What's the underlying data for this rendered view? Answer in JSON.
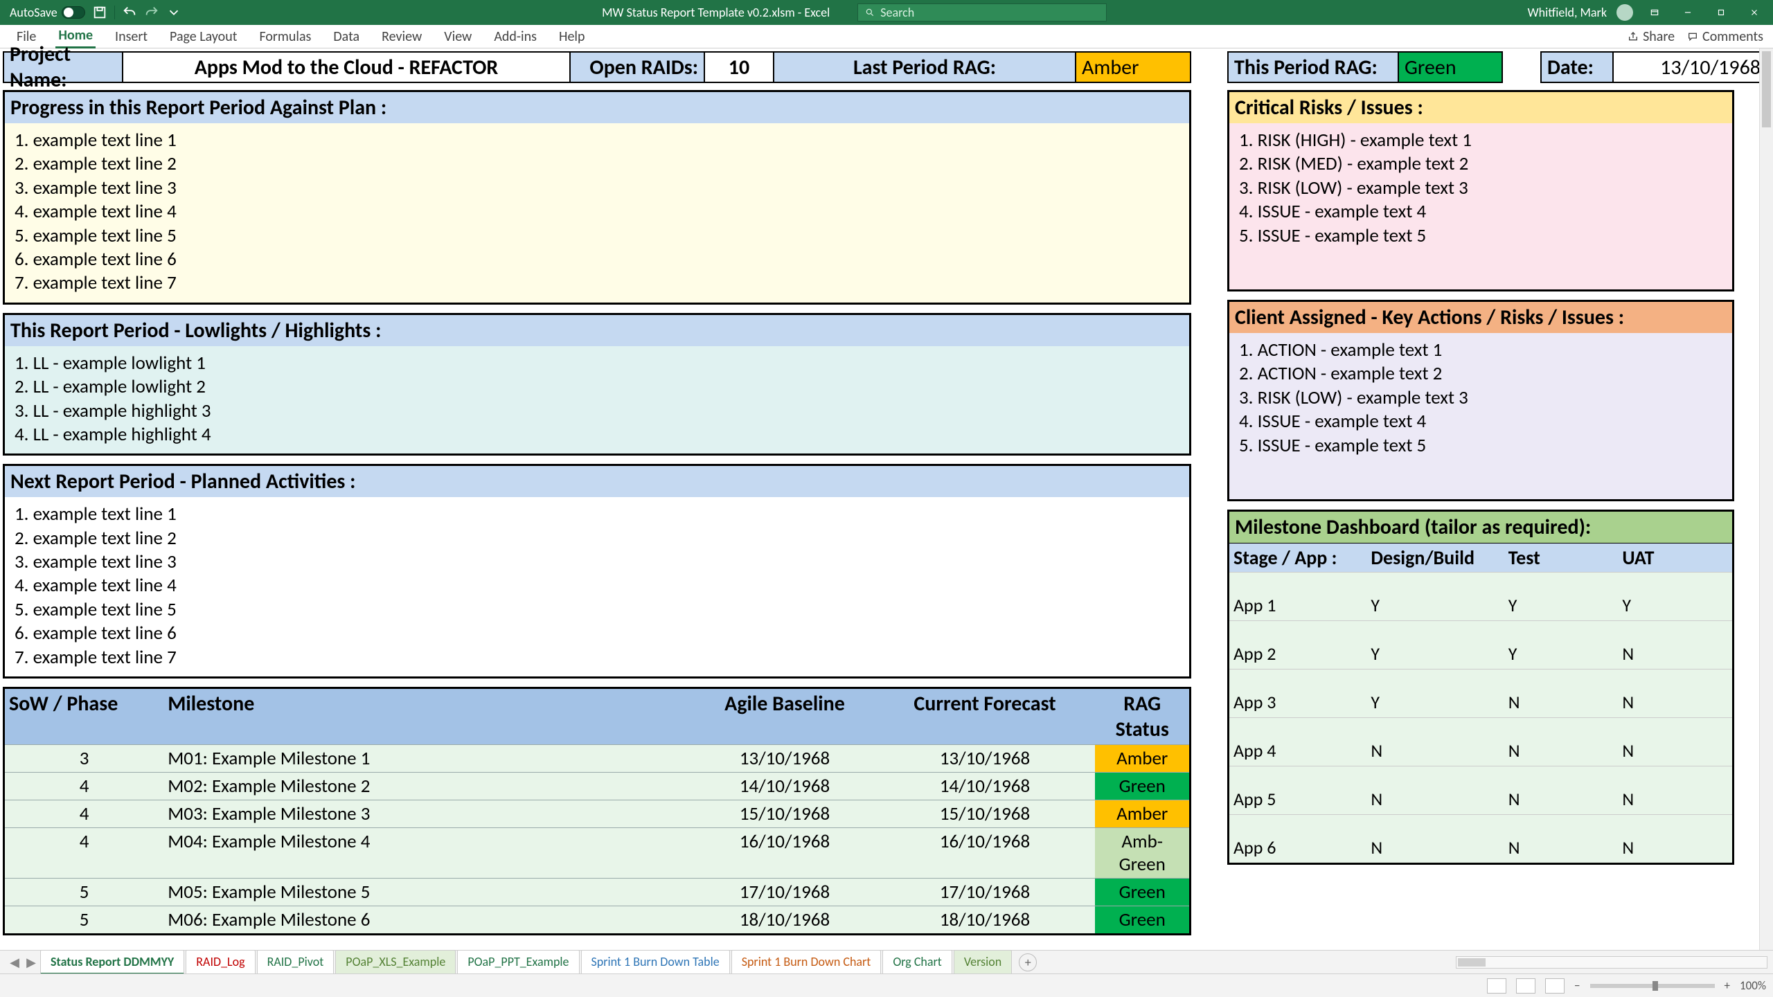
{
  "titlebar": {
    "autosave_label": "AutoSave",
    "doc_title": "MW Status Report Template v0.2.xlsm  -  Excel",
    "search_placeholder": "Search",
    "user_name": "Whitfield, Mark"
  },
  "ribbon": {
    "tabs": [
      "File",
      "Home",
      "Insert",
      "Page Layout",
      "Formulas",
      "Data",
      "Review",
      "View",
      "Add-ins",
      "Help"
    ],
    "active_index": 1,
    "share": "Share",
    "comments": "Comments"
  },
  "header": {
    "project_name_label": "Project Name:",
    "project_name": "Apps Mod to the Cloud - REFACTOR",
    "open_raids_label": "Open RAIDs:",
    "open_raids": "10",
    "last_rag_label": "Last Period RAG:",
    "last_rag": "Amber",
    "this_rag_label": "This Period RAG:",
    "this_rag": "Green",
    "date_label": "Date:",
    "date": "13/10/1968"
  },
  "progress": {
    "title": "Progress in this Report Period Against Plan :",
    "items": [
      "1. example text line 1",
      "2. example text line 2",
      "3. example text line 3",
      "4. example text line 4",
      "5. example text line 5",
      "6. example text line 6",
      "7. example text line 7"
    ]
  },
  "lowhigh": {
    "title": "This Report Period - Lowlights / Highlights :",
    "items": [
      "1. LL - example lowlight 1",
      "2. LL - example lowlight 2",
      "3. LL - example highlight 3",
      "4. LL - example highlight 4"
    ]
  },
  "planned": {
    "title": "Next Report Period - Planned Activities :",
    "items": [
      "1. example text line 1",
      "2. example text line 2",
      "3. example text line 3",
      "4. example text line 4",
      "5. example text line 5",
      "6. example text line 6",
      "7. example text line 7"
    ]
  },
  "risks": {
    "title": "Critical Risks / Issues :",
    "items": [
      "1. RISK (HIGH) - example text 1",
      "2. RISK (MED) - example text 2",
      "3. RISK (LOW) - example text 3",
      "4. ISSUE - example text 4",
      "5. ISSUE - example text 5"
    ]
  },
  "client_actions": {
    "title": "Client Assigned - Key Actions / Risks / Issues :",
    "items": [
      "1. ACTION - example text 1",
      "2. ACTION - example text 2",
      "3. RISK (LOW) - example text 3",
      "4. ISSUE - example text 4",
      "5. ISSUE - example text 5"
    ]
  },
  "milestones": {
    "cols": {
      "sow": "SoW / Phase",
      "ms": "Milestone",
      "ab": "Agile Baseline",
      "cf": "Current Forecast",
      "rag": "RAG Status"
    },
    "rows": [
      {
        "sow": "3",
        "ms": "M01: Example Milestone 1",
        "ab": "13/10/1968",
        "cf": "13/10/1968",
        "rag": "Amber",
        "cls": "rag-amber"
      },
      {
        "sow": "4",
        "ms": "M02: Example Milestone 2",
        "ab": "14/10/1968",
        "cf": "14/10/1968",
        "rag": "Green",
        "cls": "rag-green"
      },
      {
        "sow": "4",
        "ms": "M03: Example Milestone 3",
        "ab": "15/10/1968",
        "cf": "15/10/1968",
        "rag": "Amber",
        "cls": "rag-amber"
      },
      {
        "sow": "4",
        "ms": "M04: Example Milestone 4",
        "ab": "16/10/1968",
        "cf": "16/10/1968",
        "rag": "Amb-Green",
        "cls": "rag-ambgreen"
      },
      {
        "sow": "5",
        "ms": "M05: Example Milestone 5",
        "ab": "17/10/1968",
        "cf": "17/10/1968",
        "rag": "Green",
        "cls": "rag-green"
      },
      {
        "sow": "5",
        "ms": "M06: Example Milestone 6",
        "ab": "18/10/1968",
        "cf": "18/10/1968",
        "rag": "Green",
        "cls": "rag-green"
      }
    ]
  },
  "dashboard": {
    "title": "Milestone Dashboard (tailor as required):",
    "cols": {
      "stage": "Stage / App :",
      "db": "Design/Build",
      "test": "Test",
      "uat": "UAT"
    },
    "rows": [
      {
        "app": "App 1",
        "db": "Y",
        "test": "Y",
        "uat": "Y"
      },
      {
        "app": "App 2",
        "db": "Y",
        "test": "Y",
        "uat": "N"
      },
      {
        "app": "App 3",
        "db": "Y",
        "test": "N",
        "uat": "N"
      },
      {
        "app": "App 4",
        "db": "N",
        "test": "N",
        "uat": "N"
      },
      {
        "app": "App 5",
        "db": "N",
        "test": "N",
        "uat": "N"
      },
      {
        "app": "App 6",
        "db": "N",
        "test": "N",
        "uat": "N"
      }
    ]
  },
  "tabs": [
    {
      "name": "Status Report DDMMYY",
      "cls": "sel"
    },
    {
      "name": "RAID_Log",
      "cls": "red"
    },
    {
      "name": "RAID_Pivot",
      "cls": ""
    },
    {
      "name": "POaP_XLS_Example",
      "cls": "grn"
    },
    {
      "name": "POaP_PPT_Example",
      "cls": ""
    },
    {
      "name": "Sprint 1 Burn Down Table",
      "cls": "blu"
    },
    {
      "name": "Sprint 1 Burn Down Chart",
      "cls": "org"
    },
    {
      "name": "Org Chart",
      "cls": ""
    },
    {
      "name": "Version",
      "cls": "grn"
    }
  ],
  "status": {
    "zoom": "100%"
  }
}
